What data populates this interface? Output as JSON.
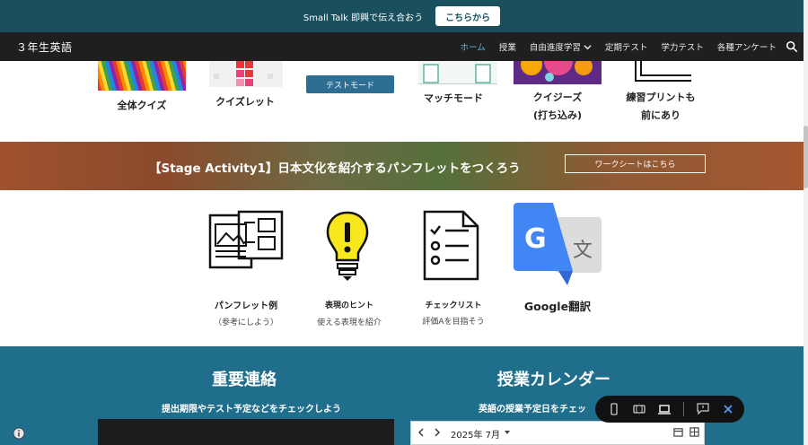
{
  "announcement": {
    "message": "Small Talk 即興で伝え合おう",
    "button_label": "こちらから"
  },
  "navbar": {
    "site_title": "３年生英語",
    "items": [
      {
        "label": "ホーム",
        "active": true
      },
      {
        "label": "授業"
      },
      {
        "label": "自由進度学習",
        "has_dropdown": true
      },
      {
        "label": "定期テスト"
      },
      {
        "label": "学力テスト"
      },
      {
        "label": "各種アンケート"
      }
    ]
  },
  "quiz_row": {
    "items": [
      {
        "label": "全体クイズ"
      },
      {
        "label": "クイズレット"
      },
      {
        "label": "マッチモード",
        "button_label": "テストモード"
      },
      {
        "label": "クイジーズ",
        "label2": "(打ち込み)"
      },
      {
        "label": "練習プリントも",
        "label2": "前にあり"
      }
    ]
  },
  "banner": {
    "title": "【Stage Activity1】日本文化を紹介するパンフレットをつくろう",
    "button_label": "ワークシートはこちら"
  },
  "resources": [
    {
      "title": "パンフレット例",
      "sub": "（参考にしよう）",
      "icon": "brochure-icon"
    },
    {
      "title": "表現のヒント",
      "sub": "使える表現を紹介",
      "icon": "lightbulb-icon"
    },
    {
      "title": "チェックリスト",
      "sub": "評価Aを目指そう",
      "icon": "checklist-icon"
    },
    {
      "title": "Google翻訳",
      "sub": "",
      "icon": "google-translate-icon"
    }
  ],
  "bottom": {
    "left_heading": "重要連絡",
    "left_sub": "提出期限やテスト予定などをチェックしよう",
    "right_heading": "授業カレンダー",
    "right_sub": "英語の授業予定日をチェッ",
    "calendar_month": "2025年 7月"
  },
  "colors": {
    "announce_bg": "#1a4f5e",
    "navbar_bg": "#1f1f1f",
    "active_nav": "#5fb3d6",
    "bottom_bg": "#1f6e8c"
  }
}
